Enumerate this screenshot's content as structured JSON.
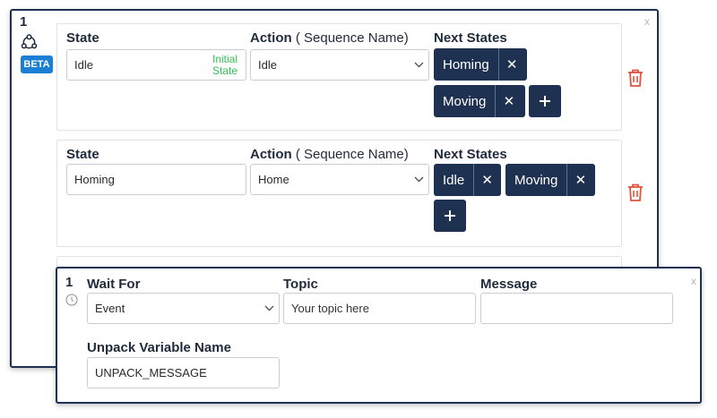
{
  "state_machine": {
    "index": "1",
    "badge": "BETA",
    "close_label": "x",
    "headers": {
      "state": "State",
      "action": "Action",
      "action_hint": "( Sequence Name)",
      "next_states": "Next States"
    },
    "initial_state_label": "Initial State",
    "rows": [
      {
        "state": "Idle",
        "action": "Idle",
        "next_states": [
          "Homing",
          "Moving"
        ],
        "initial": true
      },
      {
        "state": "Homing",
        "action": "Home",
        "next_states": [
          "Idle",
          "Moving"
        ],
        "initial": false
      }
    ],
    "add_symbol": "+",
    "remove_symbol": "✕"
  },
  "wait_step": {
    "index": "1",
    "close_label": "x",
    "wait_for_label": "Wait For",
    "wait_for_value": "Event",
    "topic_label": "Topic",
    "topic_placeholder": "Your topic here",
    "message_label": "Message",
    "message_value": "",
    "unpack_label": "Unpack Variable Name",
    "unpack_value": "UNPACK_MESSAGE"
  },
  "colors": {
    "navy": "#1f3150",
    "beta_blue": "#1b7fd3",
    "initial_green": "#35c158",
    "trash_red": "#e0533d"
  }
}
